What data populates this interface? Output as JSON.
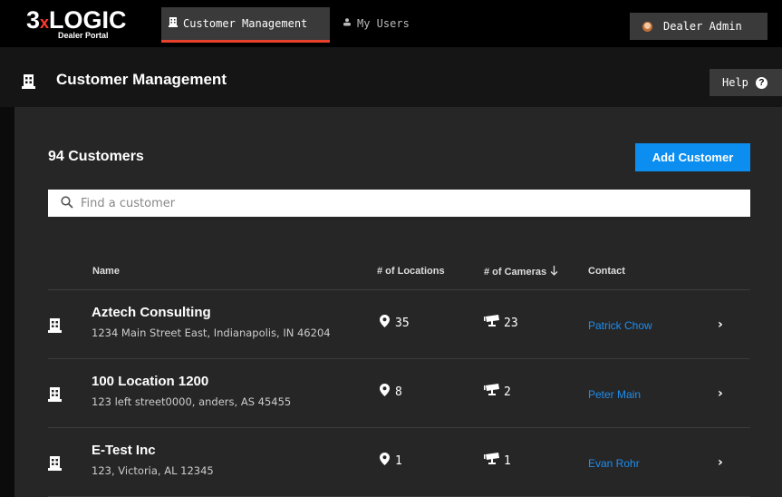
{
  "brand": {
    "logo_main_a": "3",
    "logo_x": "x",
    "logo_main_b": "LOGIC",
    "logo_sub": "Dealer Portal"
  },
  "nav": {
    "tabs": [
      {
        "label": "Customer Management",
        "icon": "building-icon",
        "active": true
      },
      {
        "label": "My Users",
        "icon": "users-icon",
        "active": false
      }
    ],
    "user_button": "Dealer Admin"
  },
  "header": {
    "title": "Customer Management",
    "help_label": "Help"
  },
  "main": {
    "count_label": "94 Customers",
    "add_button": "Add Customer",
    "search_placeholder": "Find a customer",
    "columns": {
      "name": "Name",
      "locations": "# of Locations",
      "cameras": "# of Cameras",
      "contact": "Contact"
    },
    "rows": [
      {
        "name": "Aztech Consulting",
        "address": "1234 Main Street East, Indianapolis, IN 46204",
        "locations": "35",
        "cameras": "23",
        "contact": "Patrick Chow"
      },
      {
        "name": "100 Location 1200",
        "address": "123 left street0000, anders, AS 45455",
        "locations": "8",
        "cameras": "2",
        "contact": "Peter Main"
      },
      {
        "name": "E-Test Inc",
        "address": "123, Victoria, AL 12345",
        "locations": "1",
        "cameras": "1",
        "contact": "Evan Rohr"
      }
    ]
  },
  "colors": {
    "accent": "#0b8ef0",
    "active_tab_underline": "#e8412c",
    "contact_link": "#1d8ef0"
  }
}
